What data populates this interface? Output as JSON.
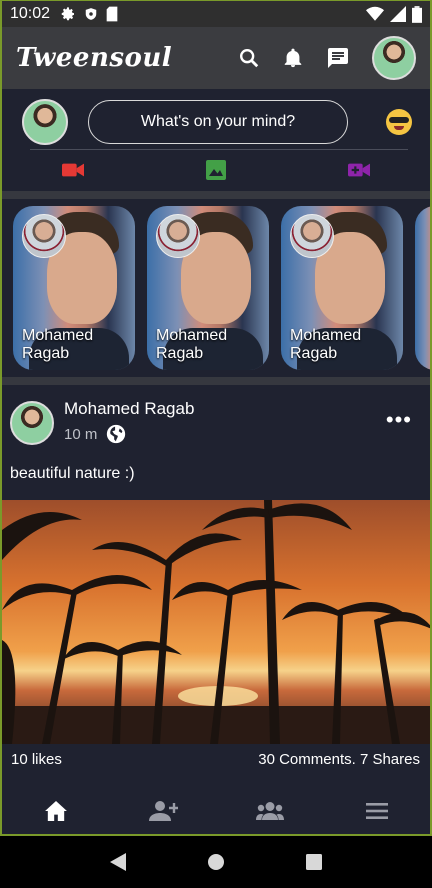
{
  "status": {
    "time": "10:02"
  },
  "app": {
    "brand": "Tweensoul"
  },
  "composer": {
    "placeholder": "What's on your mind?"
  },
  "stories": [
    {
      "name": "Mohamed Ragab"
    },
    {
      "name": "Mohamed Ragab"
    },
    {
      "name": "Mohamed Ragab"
    }
  ],
  "post": {
    "author": "Mohamed Ragab",
    "time": "10 m",
    "text": "beautiful nature :)",
    "likes": "10 likes",
    "comments_shares": "30 Comments. 7 Shares"
  },
  "icons": {
    "status": [
      "gear-icon",
      "shield-icon",
      "sdcard-icon",
      "wifi-icon",
      "signal-icon",
      "battery-icon"
    ],
    "appbar": [
      "search-icon",
      "bell-icon",
      "chat-icon"
    ],
    "media": [
      "video-icon",
      "image-icon",
      "video-add-icon"
    ],
    "bottomnav": [
      "home-icon",
      "add-friend-icon",
      "groups-icon",
      "menu-icon"
    ],
    "system": [
      "back-icon",
      "home-circle-icon",
      "recents-icon"
    ]
  },
  "colors": {
    "video": "#e53935",
    "image": "#43a047",
    "video_add": "#8e24aa",
    "background": "#1f2230",
    "appbar": "#3b3c40"
  }
}
